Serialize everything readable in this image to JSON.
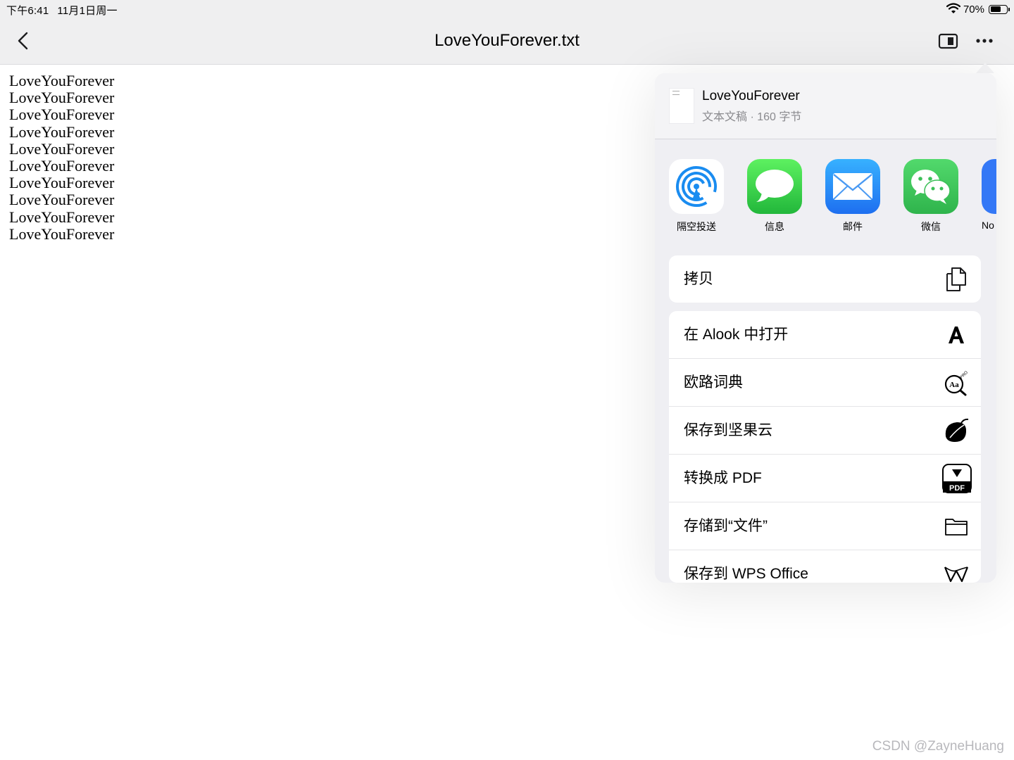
{
  "status_bar": {
    "time": "下午6:41",
    "date": "11月1日周一",
    "battery": "70%",
    "battery_level": 0.7
  },
  "nav": {
    "title": "LoveYouForever.txt",
    "back_icon": "chevron-left-icon",
    "sidebar_icon": "sidebar-toggle-icon",
    "more_icon": "ellipsis-icon"
  },
  "document": {
    "lines": [
      "LoveYouForever",
      "LoveYouForever",
      "LoveYouForever",
      "LoveYouForever",
      "LoveYouForever",
      "LoveYouForever",
      "LoveYouForever",
      "LoveYouForever",
      "LoveYouForever",
      "LoveYouForever"
    ]
  },
  "share": {
    "file_name": "LoveYouForever",
    "file_meta": "文本文稿 · 160 字节",
    "apps": [
      {
        "label": "隔空投送",
        "icon": "airdrop-icon",
        "color": "#ffffff"
      },
      {
        "label": "信息",
        "icon": "messages-icon",
        "color": "#34c759"
      },
      {
        "label": "邮件",
        "icon": "mail-icon",
        "color": "#2f8ff6"
      },
      {
        "label": "微信",
        "icon": "wechat-icon",
        "color": "#3dc35a"
      },
      {
        "label": "No",
        "icon": "notes-app-icon",
        "color": "#3478f6"
      }
    ],
    "copy_group": [
      {
        "label": "拷贝",
        "icon": "copy-icon"
      }
    ],
    "actions": [
      {
        "label": "在 Alook 中打开",
        "icon": "alook-icon"
      },
      {
        "label": "欧路词典",
        "icon": "dictionary-icon",
        "badge": "PRO"
      },
      {
        "label": "保存到坚果云",
        "icon": "nutstore-icon"
      },
      {
        "label": "转换成 PDF",
        "icon": "pdf-convert-icon",
        "badge": "PDF"
      },
      {
        "label": "存储到“文件”",
        "icon": "folder-icon"
      },
      {
        "label": "保存到 WPS Office",
        "icon": "wps-icon"
      }
    ]
  },
  "watermark": "CSDN @ZayneHuang"
}
